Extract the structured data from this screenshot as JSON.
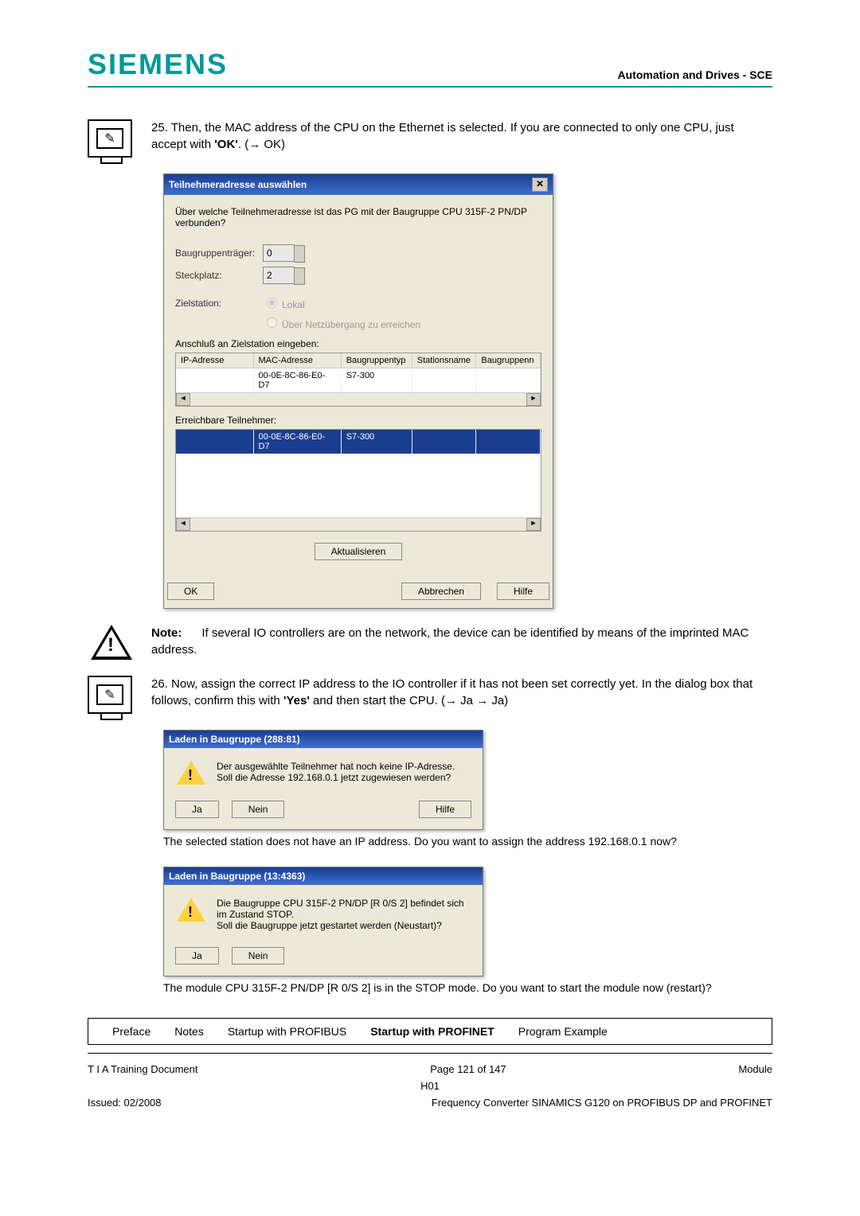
{
  "header": {
    "brand": "SIEMENS",
    "right": "Automation and Drives - SCE"
  },
  "step25": {
    "num": "25.",
    "text_a": "Then, the MAC address of the CPU on the Ethernet is selected. If you are connected to only one CPU, just accept with ",
    "ok": "'OK'",
    "text_b": ". (→ OK)"
  },
  "dialog1": {
    "title": "Teilnehmeradresse auswählen",
    "question": "Über welche Teilnehmeradresse ist das PG mit der Baugruppe CPU 315F-2 PN/DP verbunden?",
    "rack_label": "Baugruppenträger:",
    "rack_val": "0",
    "slot_label": "Steckplatz:",
    "slot_val": "2",
    "target_label": "Zielstation:",
    "radio1": "Lokal",
    "radio2": "Über Netzübergang zu erreichen",
    "conn_label": "Anschluß an Zielstation eingeben:",
    "headers": {
      "c1": "IP-Adresse",
      "c2": "MAC-Adresse",
      "c3": "Baugruppentyp",
      "c4": "Stationsname",
      "c5": "Baugruppenn"
    },
    "row": {
      "c1": "",
      "c2": "00-0E-8C-86-E0-D7",
      "c3": "S7-300",
      "c4": "",
      "c5": ""
    },
    "reach_label": "Erreichbare Teilnehmer:",
    "row2": {
      "c1": "",
      "c2": "00-0E-8C-86-E0-D7",
      "c3": "S7-300",
      "c4": "",
      "c5": ""
    },
    "update": "Aktualisieren",
    "ok": "OK",
    "cancel": "Abbrechen",
    "help": "Hilfe"
  },
  "note": {
    "label": "Note:",
    "text": "If several IO controllers are on the network, the device can be identified by means of the imprinted MAC address."
  },
  "step26": {
    "num": "26.",
    "text_a": "Now, assign the correct IP address to the IO controller if it has not been set correctly yet. In the dialog box that follows, confirm this with ",
    "yes": "'Yes'",
    "text_b": " and then start the CPU. (→ Ja → Ja)"
  },
  "dialog2": {
    "title": "Laden in Baugruppe (288:81)",
    "line1": "Der ausgewählte Teilnehmer hat noch keine IP-Adresse.",
    "line2": "Soll die Adresse 192.168.0.1 jetzt zugewiesen werden?",
    "ja": "Ja",
    "nein": "Nein",
    "help": "Hilfe"
  },
  "caption2": "The selected station does not have an IP address. Do you want to assign the address 192.168.0.1 now?",
  "dialog3": {
    "title": "Laden in Baugruppe (13:4363)",
    "line1": "Die Baugruppe CPU 315F-2 PN/DP [R 0/S 2] befindet sich im Zustand STOP.",
    "line2": "Soll die Baugruppe jetzt gestartet werden (Neustart)?",
    "ja": "Ja",
    "nein": "Nein"
  },
  "caption3": "The module CPU 315F-2 PN/DP [R 0/S 2] is in the STOP mode. Do you want to start the module now (restart)?",
  "nav": {
    "t1": "Preface",
    "t2": "Notes",
    "t3": "Startup with PROFIBUS",
    "t4": "Startup with PROFINET",
    "t5": "Program Example"
  },
  "footer": {
    "left1": "T I A Training Document",
    "center1": "Page 121 of 147",
    "center2": "H01",
    "right1": "Module",
    "left2": "Issued: 02/2008",
    "right2": "Frequency Converter SINAMICS G120 on PROFIBUS DP and PROFINET"
  }
}
